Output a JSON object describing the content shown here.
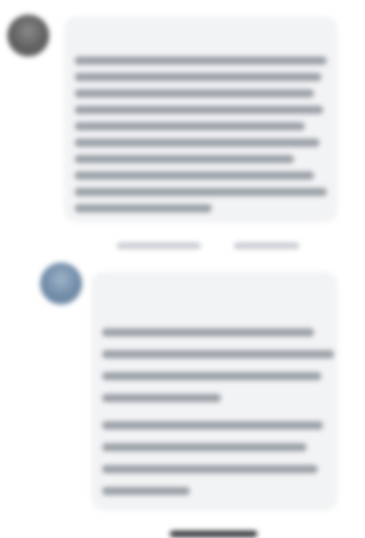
{
  "comments": [
    {
      "author": "",
      "body_lines": [
        "",
        "",
        "",
        "",
        "",
        "",
        "",
        "",
        "",
        ""
      ],
      "actions": [
        "",
        ""
      ]
    },
    {
      "author": "",
      "subline": "",
      "body_lines": [
        "",
        "",
        "",
        "",
        "",
        "",
        "",
        "",
        ""
      ],
      "actions": [
        ""
      ]
    }
  ],
  "colors": {
    "bubble": "#f2f3f5",
    "text": "#1c1e21",
    "link": "#3b6fb0"
  }
}
